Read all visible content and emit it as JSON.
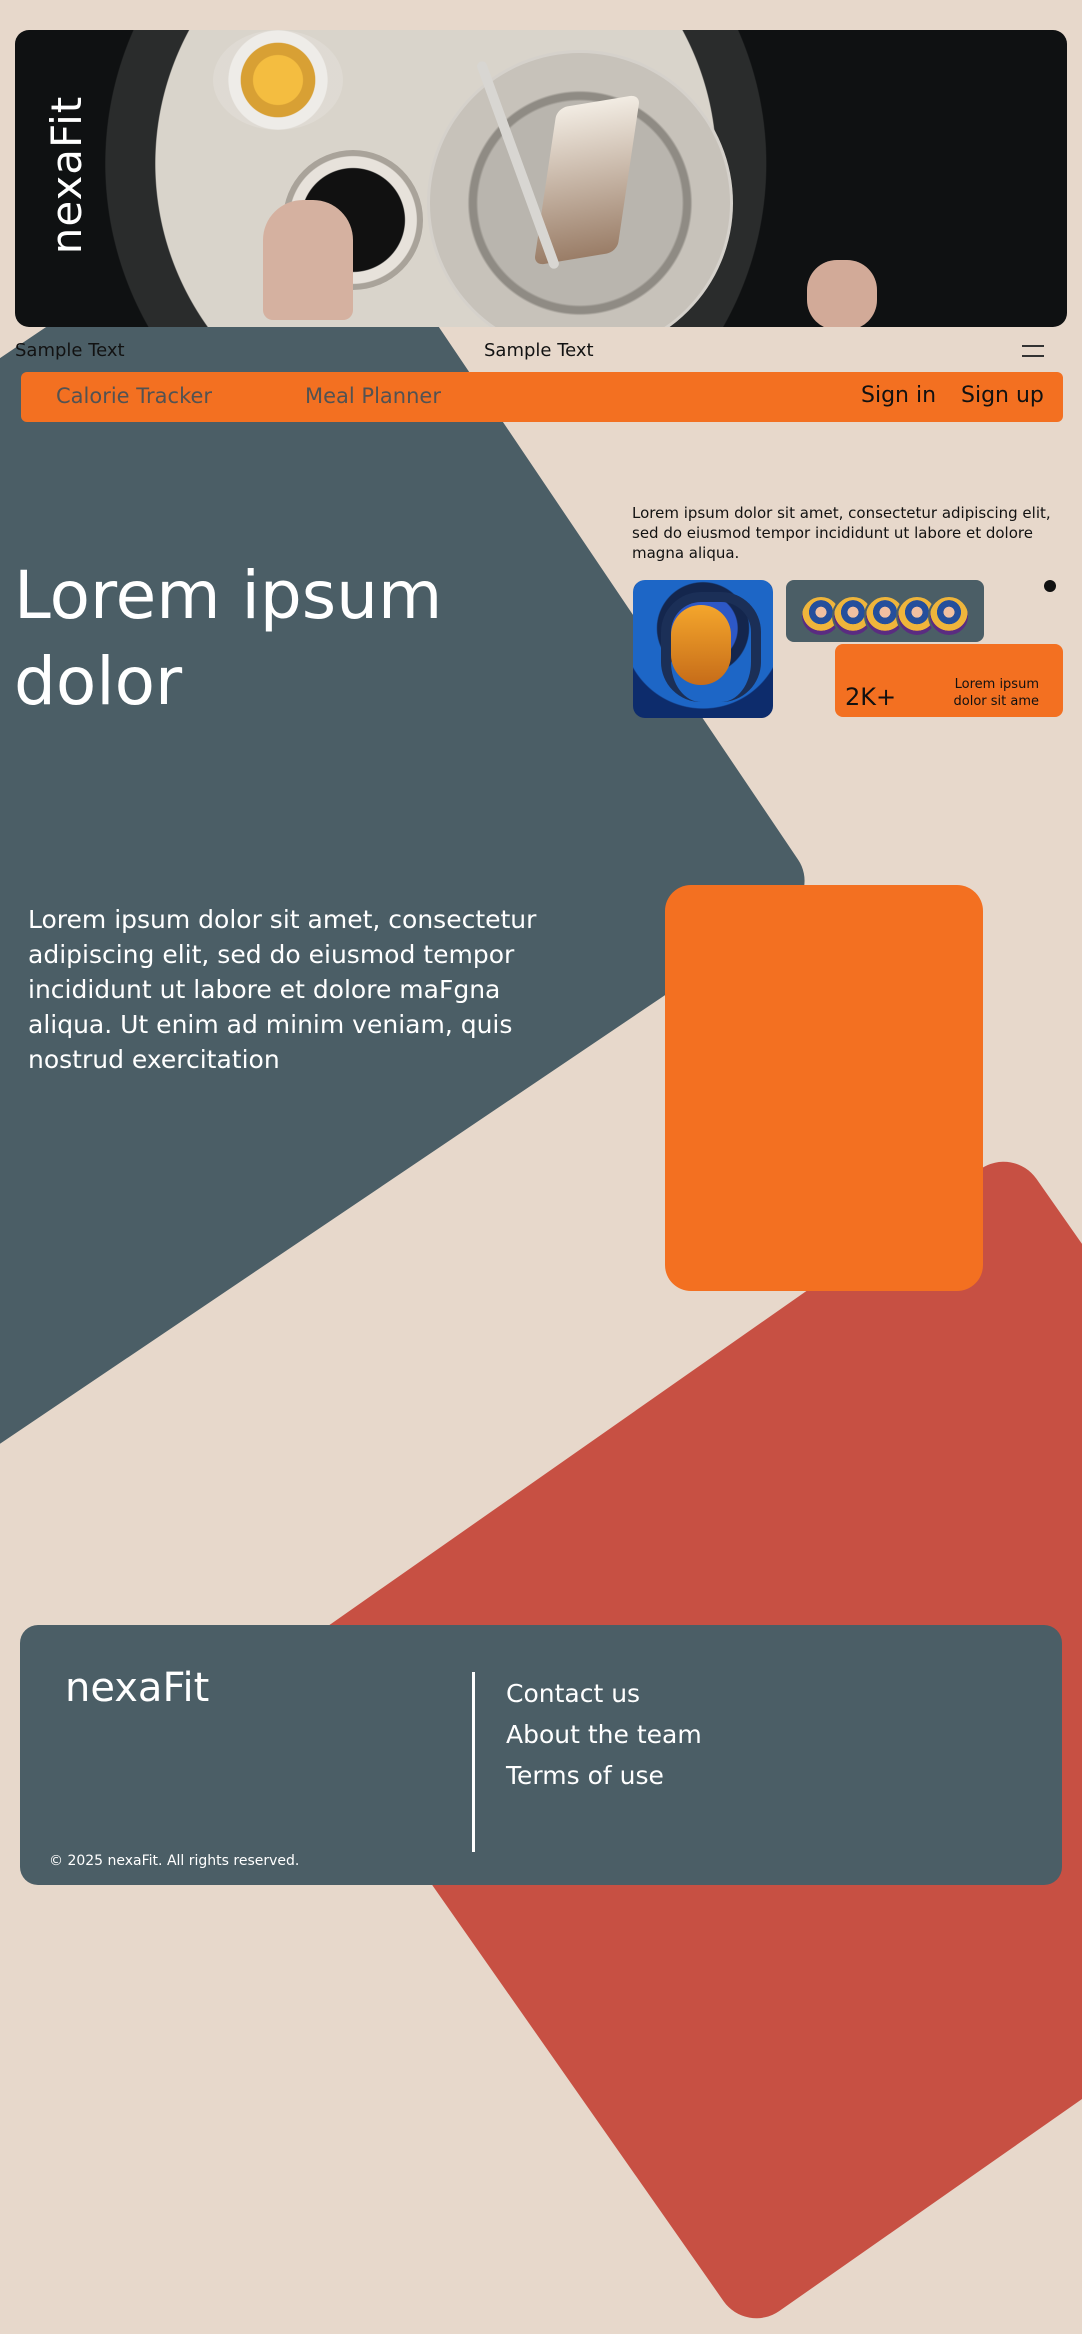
{
  "brand": {
    "name": "nexaFit"
  },
  "top_bar": {
    "left_text": "Sample Text",
    "center_text": "Sample Text"
  },
  "nav": {
    "items": [
      {
        "label": "Calorie Tracker"
      },
      {
        "label": "Meal Planner"
      }
    ],
    "sign_in": "Sign in",
    "sign_up": "Sign up"
  },
  "hero": {
    "headline_line_1": "Lorem ipsum",
    "headline_line_2": "dolor",
    "intro": "Lorem ipsum dolor sit amet, consectetur adipiscing elit, sed do eiusmod tempor incididunt ut labore et dolore magna aliqua.",
    "stat_value": "2K+",
    "stat_label": "Lorem ipsum dolor sit ame"
  },
  "content": {
    "paragraph": "Lorem ipsum dolor sit amet, consectetur adipiscing elit, sed do eiusmod tempor incididunt ut labore et dolore maFgna aliqua. Ut enim ad minim veniam, quis nostrud exercitation"
  },
  "footer": {
    "brand": "nexaFit",
    "links": [
      {
        "label": "Contact us"
      },
      {
        "label": "About the team"
      },
      {
        "label": "Terms of use"
      }
    ],
    "copyright": "© 2025 nexaFit. All rights reserved."
  },
  "colors": {
    "background": "#e7d8cb",
    "slate": "#4b5e66",
    "orange": "#f37021",
    "red": "#c75043",
    "text_dark": "#121212",
    "text_light": "#ffffff"
  },
  "icons": {
    "menu": "hamburger-icon"
  }
}
